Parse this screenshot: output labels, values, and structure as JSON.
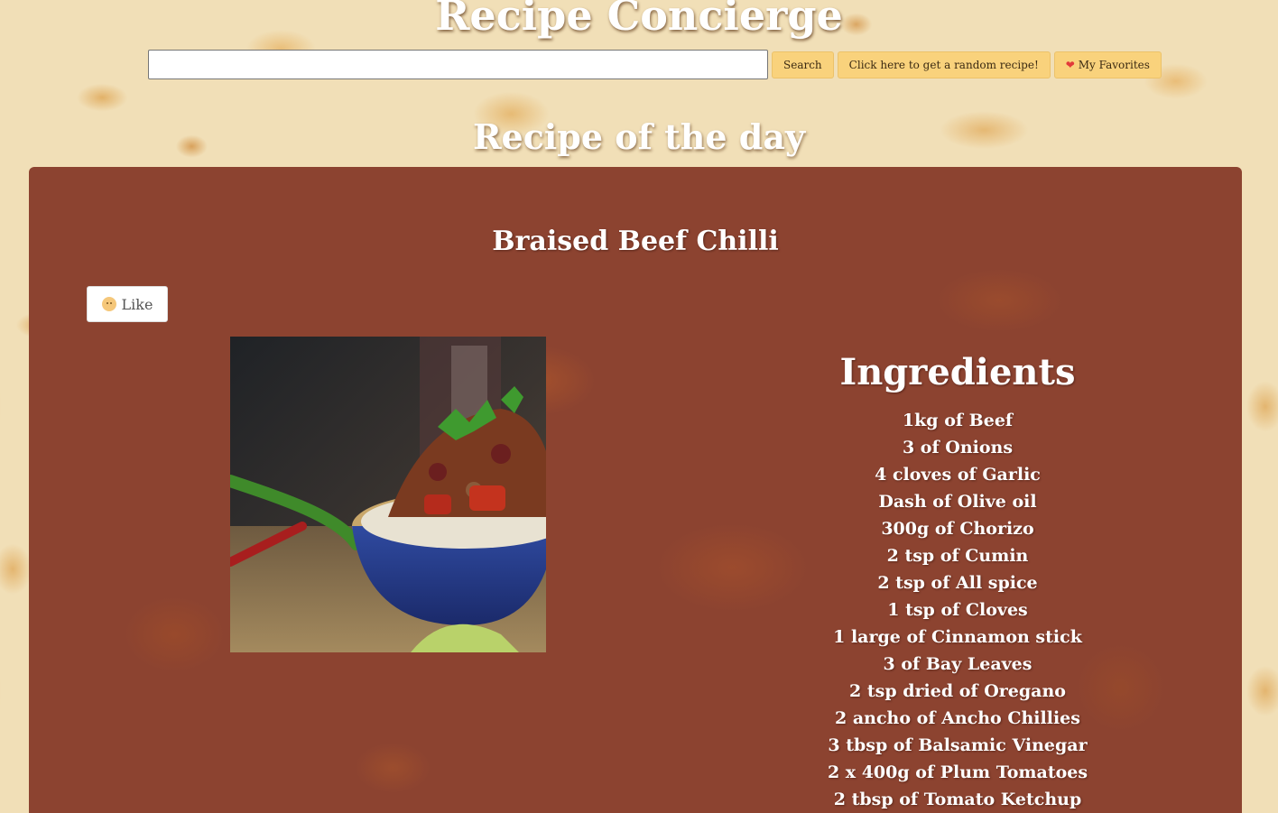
{
  "header": {
    "site_title": "Recipe Concierge",
    "search": {
      "value": "",
      "placeholder": ""
    },
    "search_button_label": "Search",
    "random_button_label": "Click here to get a random recipe!",
    "favorites_button_label": "My Favorites",
    "favorites_icon": "heart-icon"
  },
  "section_title": "Recipe of the day",
  "recipe": {
    "title": "Braised Beef Chilli",
    "like_label": "Like",
    "like_icon": "smiley-face-icon",
    "image_alt": "Braised Beef Chilli",
    "ingredients_title": "Ingredients",
    "ingredients": [
      "1kg of Beef",
      "3 of Onions",
      "4 cloves of Garlic",
      "Dash of Olive oil",
      "300g of Chorizo",
      "2 tsp of Cumin",
      "2 tsp of All spice",
      "1 tsp of Cloves",
      "1 large of Cinnamon stick",
      "3 of Bay Leaves",
      "2 tsp dried of Oregano",
      "2 ancho of Ancho Chillies",
      "3 tbsp of Balsamic Vinegar",
      "2 x 400g of Plum Tomatoes",
      "2 tbsp of Tomato Ketchup"
    ]
  },
  "colors": {
    "page_background": "#f1dfb7",
    "card_background": "#8c4330",
    "button_background": "#f9d27c",
    "heading_text": "#ffffff"
  }
}
